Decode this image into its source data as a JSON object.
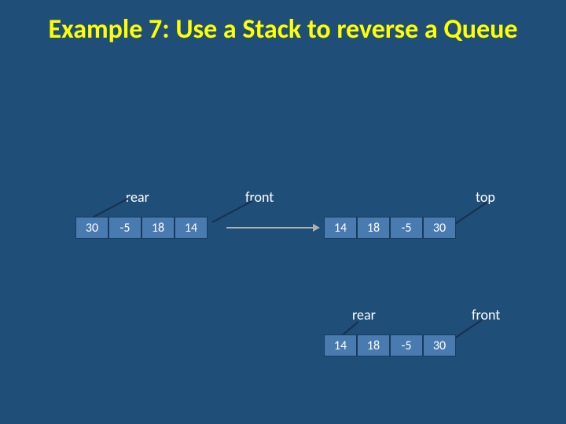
{
  "title": "Example 7: Use a Stack to reverse a Queue",
  "labels": {
    "rear1": "rear",
    "front1": "front",
    "top": "top",
    "rear2": "rear",
    "front2": "front"
  },
  "queue1": [
    "30",
    "-5",
    "18",
    "14"
  ],
  "stack": [
    "14",
    "18",
    "-5",
    "30"
  ],
  "queue2": [
    "14",
    "18",
    "-5",
    "30"
  ]
}
